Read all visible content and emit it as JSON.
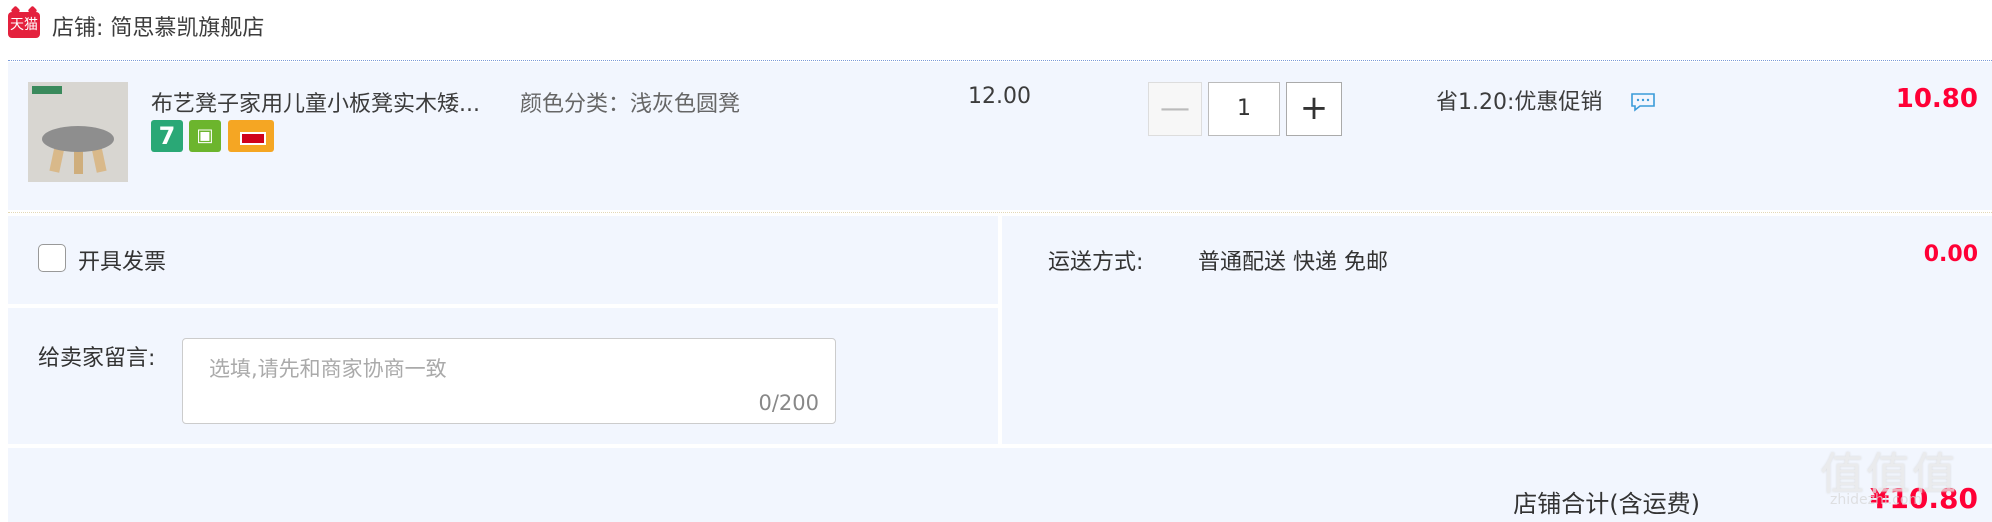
{
  "shop": {
    "logo_text": "天猫",
    "label": "店铺: 简思慕凯旗舰店"
  },
  "item": {
    "title": "布艺凳子家用儿童小板凳实木矮...",
    "spec": "颜色分类：浅灰色圆凳",
    "unit_price": "12.00",
    "quantity": "1",
    "minus_symbol": "—",
    "plus_symbol": "+",
    "promotion": "省1.20:优惠促销",
    "subtotal": "10.80",
    "badges": [
      "7",
      "bag",
      "card"
    ]
  },
  "invoice": {
    "label": "开具发票",
    "checked": false
  },
  "message": {
    "label": "给卖家留言:",
    "placeholder": "选填,请先和商家协商一致",
    "counter": "0/200"
  },
  "shipping": {
    "label": "运送方式:",
    "method": "普通配送 快递 免邮",
    "fee": "0.00"
  },
  "total": {
    "label": "店铺合计(含运费)",
    "amount": "¥10.80"
  },
  "colors": {
    "price_red": "#ff0036",
    "panel_bg": "#f2f6fe",
    "tmall_red": "#e4213d"
  }
}
